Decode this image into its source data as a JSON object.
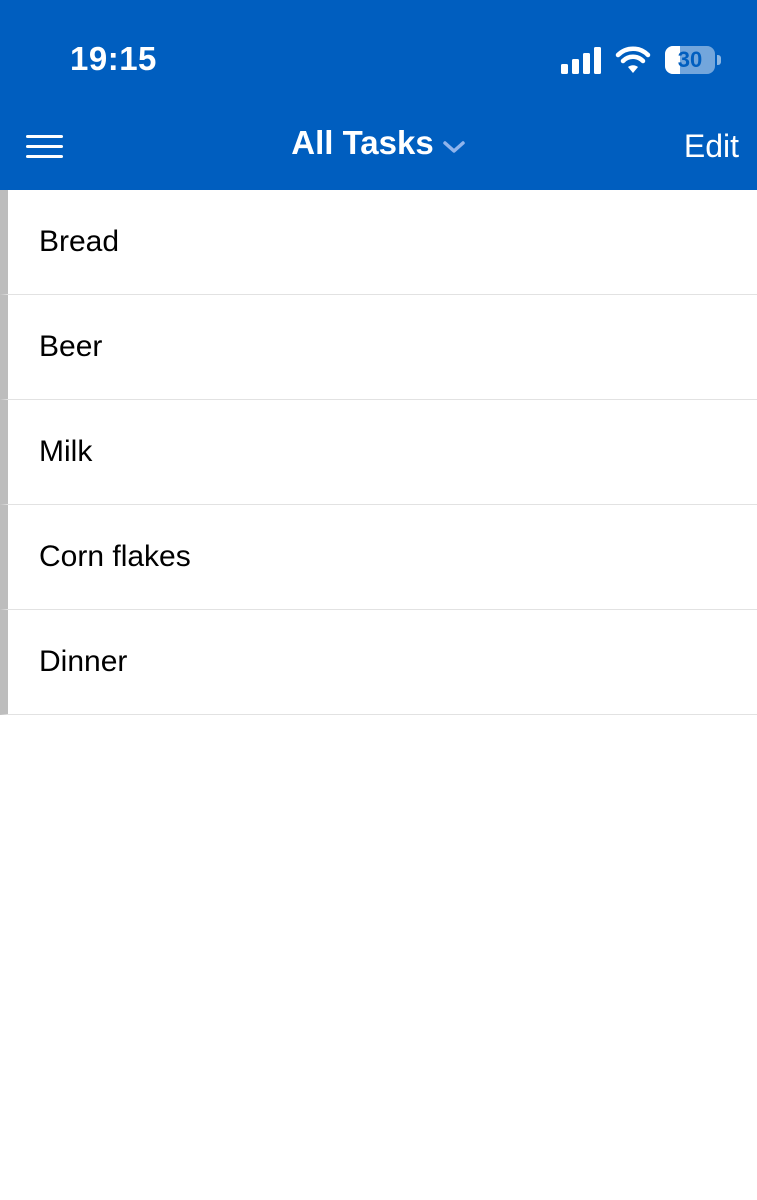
{
  "status_bar": {
    "time": "19:15",
    "battery_level": "30",
    "battery_fraction": 0.3
  },
  "nav": {
    "title": "All Tasks",
    "edit_label": "Edit",
    "menu_icon": "hamburger-menu-icon",
    "title_icon": "chevron-down-icon"
  },
  "tasks": [
    {
      "label": "Bread"
    },
    {
      "label": "Beer"
    },
    {
      "label": "Milk"
    },
    {
      "label": "Corn flakes"
    },
    {
      "label": "Dinner"
    }
  ],
  "colors": {
    "header_bg": "#005ebf",
    "header_text": "#ffffff",
    "row_marker": "#bdbdbd",
    "divider": "#e2e2e2",
    "chevron": "#8fb4ec"
  }
}
